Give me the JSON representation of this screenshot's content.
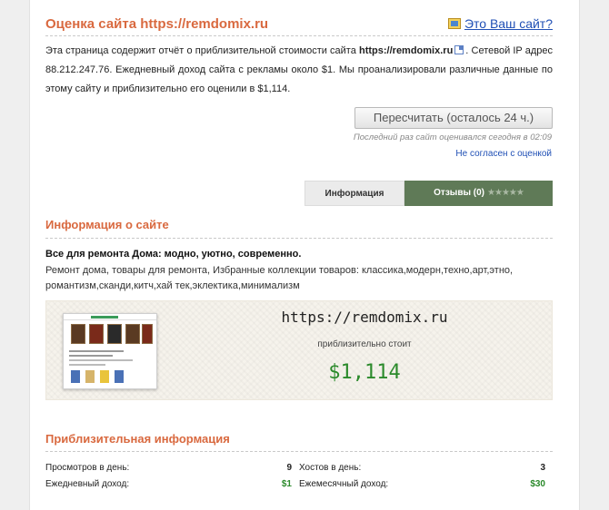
{
  "header": {
    "title": "Оценка сайта https://remdomix.ru",
    "own_site_link": "Это Ваш сайт?"
  },
  "description": {
    "part1": "Эта страница содержит отчёт о приблизительной стоимости сайта",
    "domain": "https://remdomix.ru",
    "part2": ". Сетевой IP адрес 88.212.247.76. Ежедневный доход сайта с рекламы около $1. Мы проанализировали различные данные по этому сайту и приблизительно его оценили в $1,114."
  },
  "actions": {
    "recalc_button": "Пересчитать (осталось 24 ч.)",
    "last_check": "Последний раз сайт оценивался сегодня в 02:09",
    "disagree_link": "Не согласен с оценкой"
  },
  "tabs": {
    "info": "Информация",
    "reviews": "Отзывы (0)",
    "reviews_stars": "★★★★★"
  },
  "site_info": {
    "section_title": "Информация о сайте",
    "name": "Все для ремонта Дома: модно, уютно, современно.",
    "description": "Ремонт дома, товары для ремонта, Избранные коллекции товаров: классика,модерн,техно,арт,этно, романтизм,сканди,китч,хай тек,эклектика,минимализм"
  },
  "valuation": {
    "url": "https://remdomix.ru",
    "label": "приблизительно стоит",
    "price": "$1,114"
  },
  "approx": {
    "section_title": "Приблизительная информация",
    "rows": [
      {
        "left_label": "Просмотров в день:",
        "left_value": "9",
        "right_label": "Хостов в день:",
        "right_value": "3"
      },
      {
        "left_label": "Ежедневный доход:",
        "left_value": "$1",
        "right_label": "Ежемесячный доход:",
        "right_value": "$30"
      }
    ]
  },
  "colors": {
    "accent": "#d9693f",
    "link": "#1f4fb5",
    "money": "#2b8a2b",
    "tab_active": "#5f7a57"
  }
}
